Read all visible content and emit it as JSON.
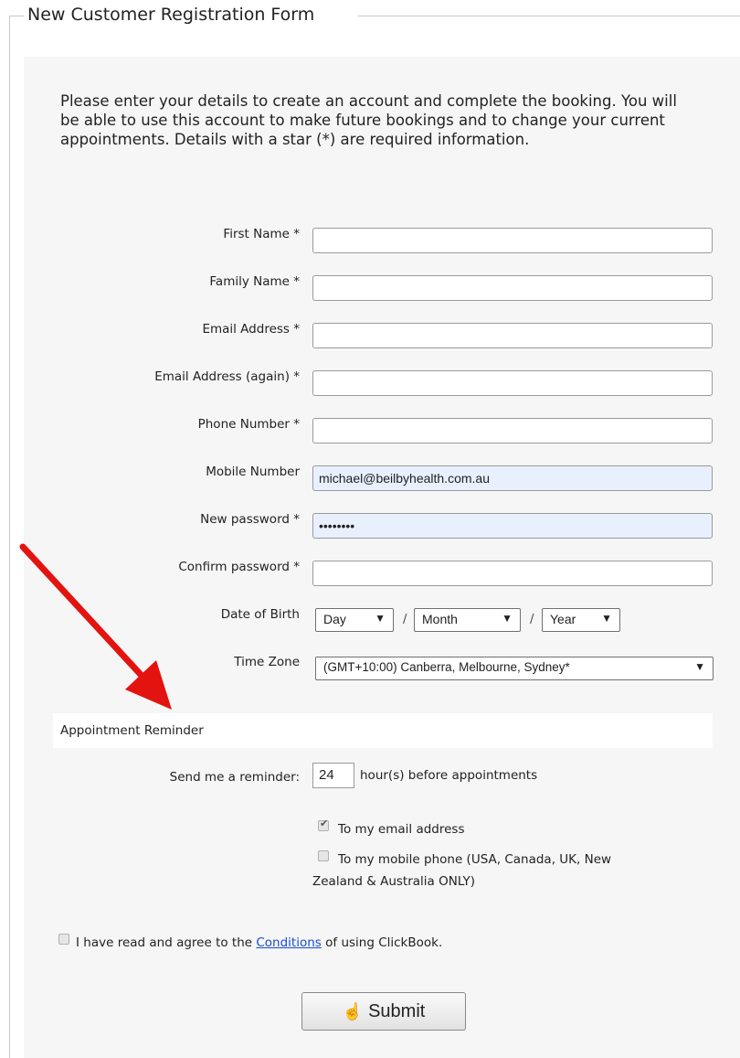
{
  "form": {
    "legend": "New Customer Registration Form",
    "intro": "Please enter your details to create an account and complete the booking. You will be able to use this account to make future bookings and to change your current appointments. Details with a star (*) are required information."
  },
  "fields": {
    "first_name": {
      "label": "First Name *",
      "value": ""
    },
    "family_name": {
      "label": "Family Name *",
      "value": ""
    },
    "email": {
      "label": "Email Address *",
      "value": ""
    },
    "email_again": {
      "label": "Email Address (again) *",
      "value": ""
    },
    "phone": {
      "label": "Phone Number *",
      "value": ""
    },
    "mobile": {
      "label": "Mobile Number",
      "value": "michael@beilbyhealth.com.au"
    },
    "new_password": {
      "label": "New password *",
      "value": "••••••••"
    },
    "confirm_password": {
      "label": "Confirm password *",
      "value": ""
    },
    "dob": {
      "label": "Date of Birth",
      "day": "Day",
      "month": "Month",
      "year": "Year",
      "separator": "/"
    },
    "timezone": {
      "label": "Time Zone",
      "value": "(GMT+10:00) Canberra, Melbourne, Sydney*"
    }
  },
  "reminder": {
    "section_title": "Appointment Reminder",
    "send_label": "Send me a reminder:",
    "hours_value": "24",
    "hours_suffix": "hour(s) before appointments",
    "email_option": {
      "label": "To my email address",
      "checked": true
    },
    "mobile_option": {
      "label_line1": "To my mobile phone (USA, Canada, UK, New",
      "label_line2": "Zealand & Australia ONLY)",
      "checked": false
    }
  },
  "terms": {
    "prefix": "I have read and agree to the",
    "link": "Conditions",
    "suffix": "of using ClickBook."
  },
  "submit_label": "Submit",
  "colors": {
    "annotation_arrow": "#e3130f",
    "autofill_bg": "#e8f0fe",
    "link": "#1a4cd6"
  },
  "icons": {
    "submit": "pointing-hand-icon",
    "dropdown": "triangle-down-icon"
  }
}
